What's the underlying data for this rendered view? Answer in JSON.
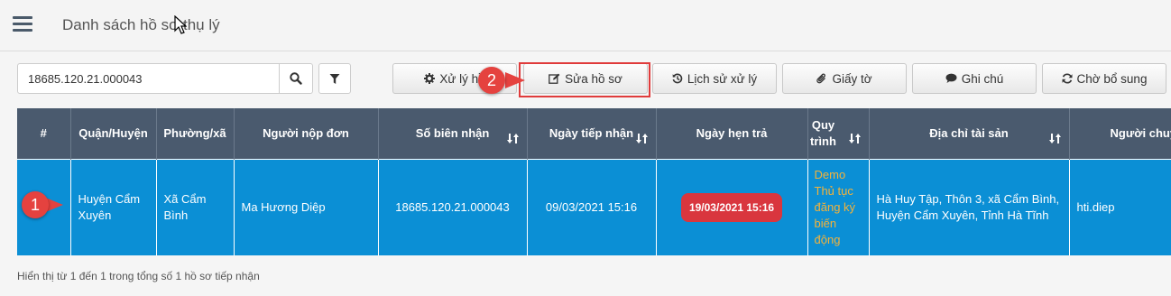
{
  "header": {
    "title": "Danh sách hồ sơ thụ lý"
  },
  "search": {
    "value": "18685.120.21.000043"
  },
  "toolbar": {
    "buttons": [
      {
        "label": "Xử lý hồ",
        "icon": "gear-icon"
      },
      {
        "label": "Sửa hồ sơ",
        "icon": "edit-icon"
      },
      {
        "label": "Lịch sử xử lý",
        "icon": "history-icon"
      },
      {
        "label": "Giấy tờ",
        "icon": "paperclip-icon"
      },
      {
        "label": "Ghi chú",
        "icon": "comment-icon"
      },
      {
        "label": "Chờ bổ sung",
        "icon": "refresh-icon"
      }
    ]
  },
  "annotations": {
    "step1": "1",
    "step2": "2",
    "color": "#e5423f"
  },
  "table": {
    "columns": [
      "#",
      "Quận/Huyện",
      "Phường/xã",
      "Người nộp đơn",
      "Số biên nhận",
      "Ngày tiếp nhận",
      "Ngày hẹn trả",
      "Quy trình",
      "Địa chỉ tài sản",
      "Người chuy"
    ],
    "rows": [
      {
        "index": "",
        "district": "Huyện Cẩm Xuyên",
        "ward": "Xã Cẩm Bình",
        "applicant": "Ma Hương Diệp",
        "receipt_no": "18685.120.21.000043",
        "received_date": "09/03/2021 15:16",
        "due_date": "19/03/2021 15:16",
        "process": "Demo Thủ tục đăng ký biến động",
        "address": "Hà Huy Tập, Thôn 3, xã Cẩm Bình, Huyện Cẩm Xuyên, Tỉnh Hà Tĩnh",
        "handler": "hti.diep"
      }
    ],
    "header_color": "#4a5a6e",
    "row_color": "#0b8fd5",
    "due_badge_color": "#d9363e",
    "process_color": "#f3b23a"
  },
  "footer": {
    "summary": "Hiển thị từ 1 đến 1 trong tổng số 1 hồ sơ tiếp nhận"
  }
}
